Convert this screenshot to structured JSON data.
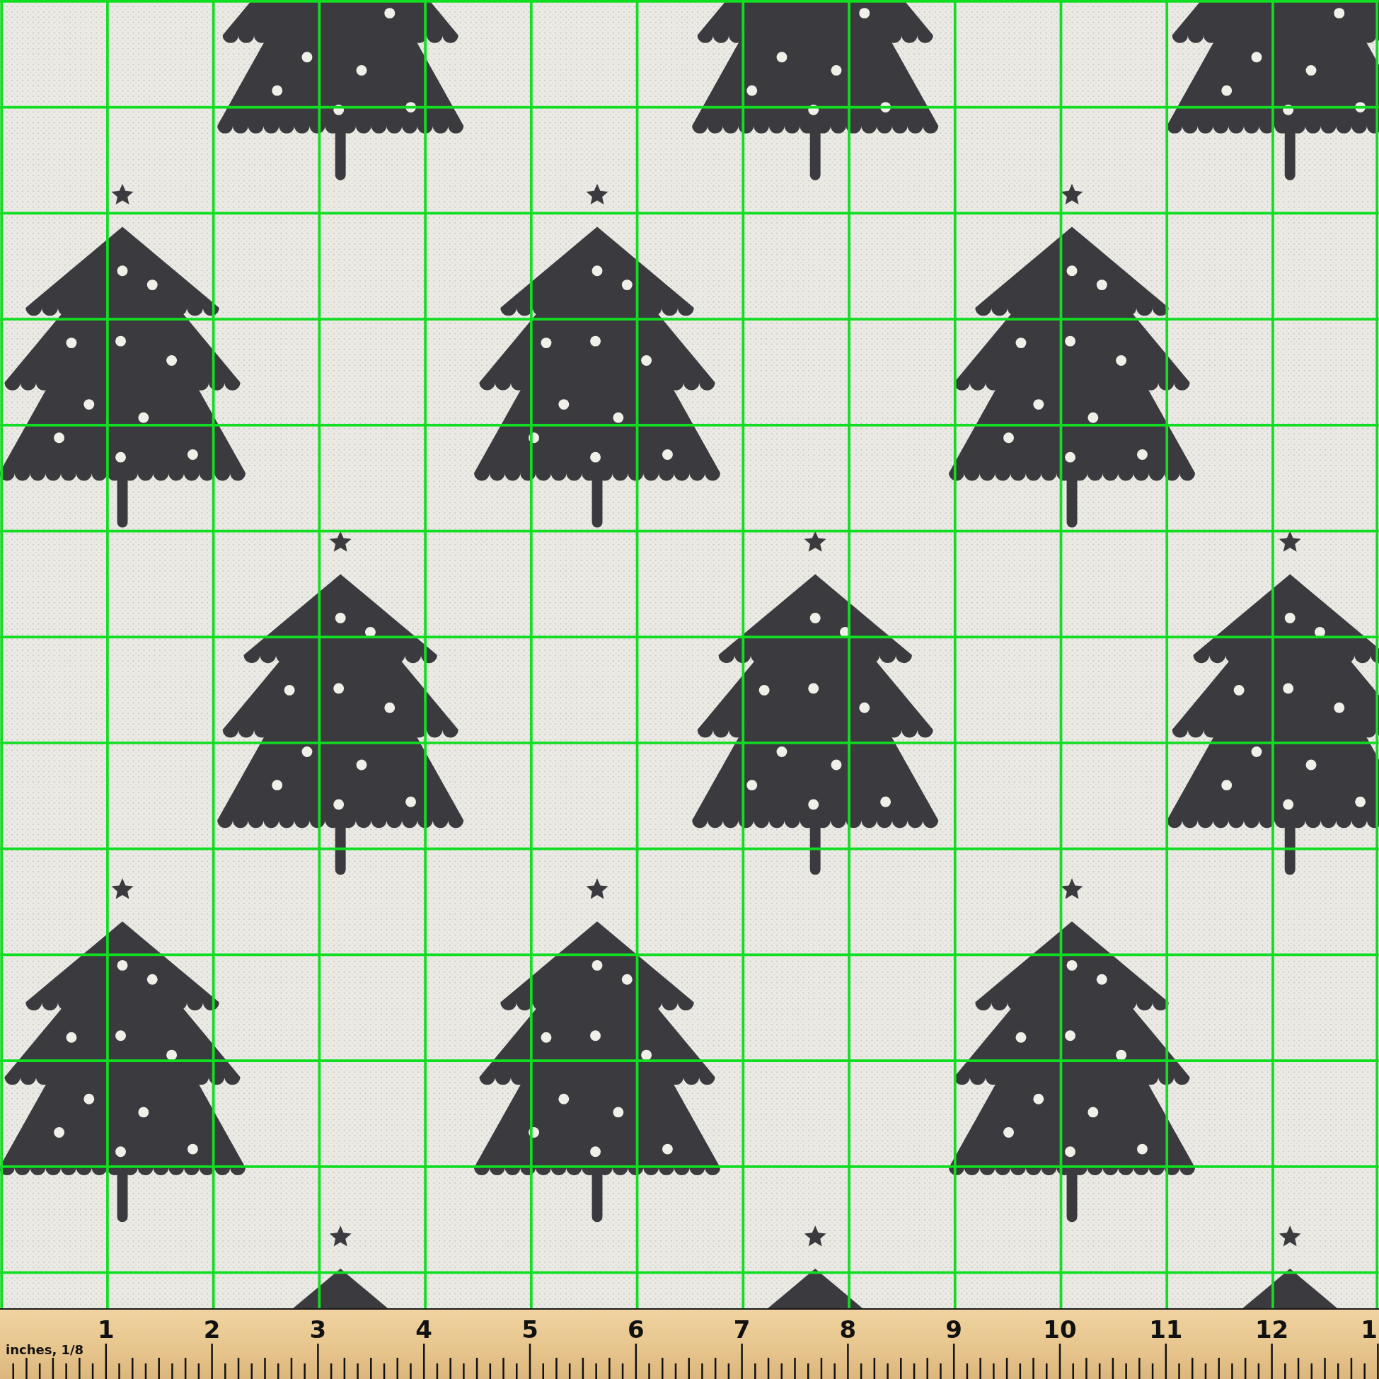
{
  "fabric": {
    "ruler": {
      "unit_label": "inches, 1/8",
      "numbers": [
        "1",
        "2",
        "3",
        "4",
        "5",
        "6",
        "7",
        "8",
        "9",
        "10",
        "11",
        "12",
        "1"
      ]
    }
  }
}
